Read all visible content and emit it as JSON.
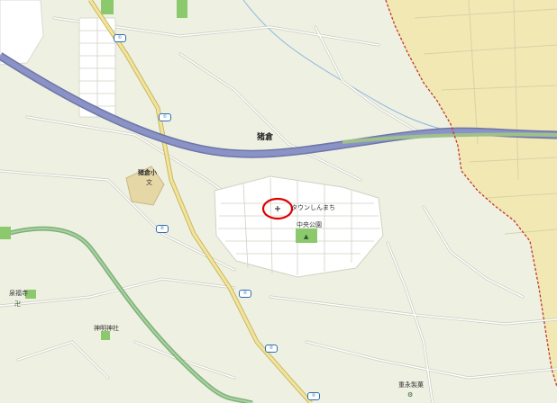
{
  "map": {
    "labels": {
      "area_north": "猪倉",
      "school": "猪倉小",
      "school_symbol": "文",
      "town": "タウンしんまち",
      "park": "中央公園",
      "shrine": "神明神社",
      "temple": "泉福寺",
      "facility": "重永製菓"
    },
    "route_shields": [
      "①",
      "②"
    ],
    "colors": {
      "land": "#eef0e2",
      "expressway": "#8b93c6",
      "expressway_edge": "#6d76a8",
      "main_road": "#f2e3a0",
      "main_road_edge": "#c9b85a",
      "local_road": "#ffffff",
      "road_casing": "#c8cbbd",
      "railway": "#7db07a",
      "green": "#8cc86c",
      "neighbor_area": "#f2e8b4",
      "boundary": "#c0392b",
      "river": "#8bb7e0",
      "marker": "#e00000"
    },
    "marker_icon": "location-circle-marker"
  }
}
